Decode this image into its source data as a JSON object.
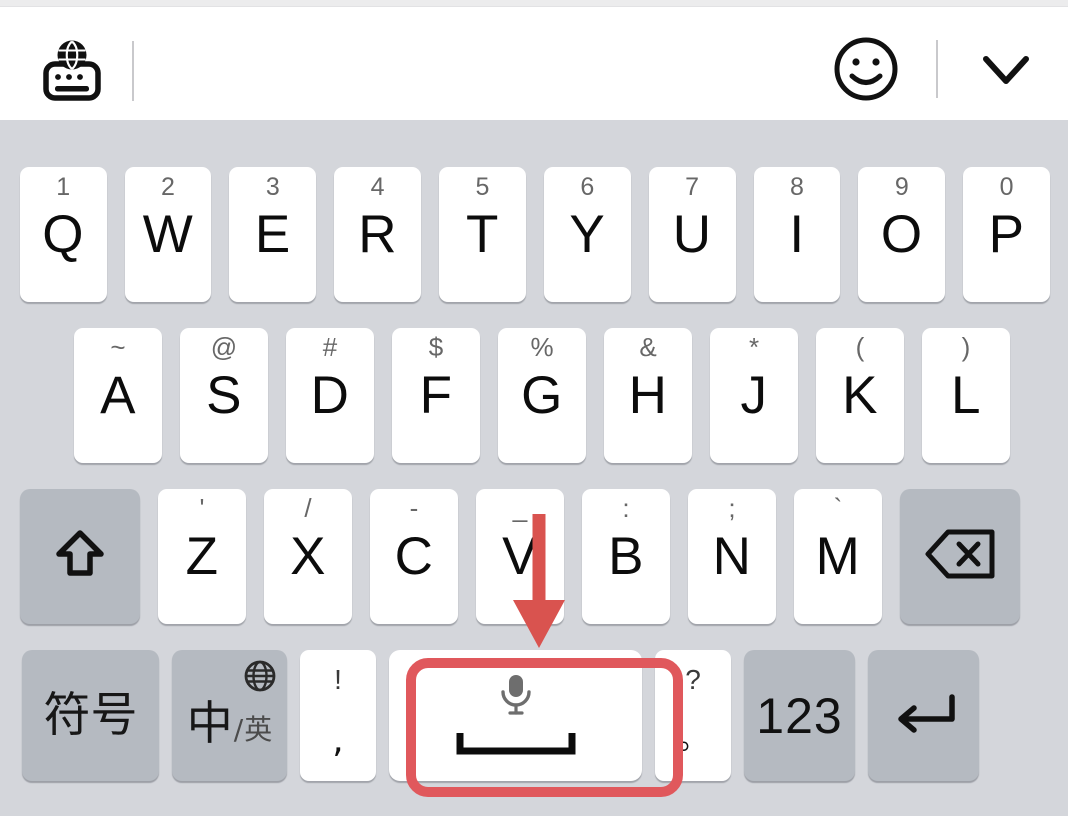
{
  "app": {
    "type": "mobile-soft-keyboard",
    "layout_name": "qwerty-chinese-pinyin"
  },
  "toolbar": {
    "left_icon": "globe-keyboard-icon",
    "left_icon_label": "switch-input-method",
    "divider": "|",
    "emoji_icon": "smiley-face-icon",
    "emoji_label": "emoji",
    "collapse_icon": "chevron-down-icon",
    "collapse_label": "hide-keyboard"
  },
  "keyboard": {
    "rows": [
      {
        "name": "row-1",
        "keys": [
          {
            "main": "Q",
            "sup": "1"
          },
          {
            "main": "W",
            "sup": "2"
          },
          {
            "main": "E",
            "sup": "3"
          },
          {
            "main": "R",
            "sup": "4"
          },
          {
            "main": "T",
            "sup": "5"
          },
          {
            "main": "Y",
            "sup": "6"
          },
          {
            "main": "U",
            "sup": "7"
          },
          {
            "main": "I",
            "sup": "8"
          },
          {
            "main": "O",
            "sup": "9"
          },
          {
            "main": "P",
            "sup": "0"
          }
        ]
      },
      {
        "name": "row-2",
        "keys": [
          {
            "main": "A",
            "sup": "~"
          },
          {
            "main": "S",
            "sup": "@"
          },
          {
            "main": "D",
            "sup": "#"
          },
          {
            "main": "F",
            "sup": "$"
          },
          {
            "main": "G",
            "sup": "%"
          },
          {
            "main": "H",
            "sup": "&"
          },
          {
            "main": "J",
            "sup": "*"
          },
          {
            "main": "K",
            "sup": "("
          },
          {
            "main": "L",
            "sup": ")"
          }
        ]
      },
      {
        "name": "row-3",
        "shift_icon": "shift-up-arrow-icon",
        "shift_label": "shift",
        "backspace_icon": "backspace-delete-icon",
        "backspace_label": "backspace",
        "keys": [
          {
            "main": "Z",
            "sup": "'"
          },
          {
            "main": "X",
            "sup": "/"
          },
          {
            "main": "C",
            "sup": "-"
          },
          {
            "main": "V",
            "sup": "_"
          },
          {
            "main": "B",
            "sup": ":"
          },
          {
            "main": "N",
            "sup": ";"
          },
          {
            "main": "M",
            "sup": "`"
          }
        ]
      }
    ],
    "bottom_row": {
      "symbols_label": "符号",
      "lang_zh": "中",
      "lang_sep": "/",
      "lang_en": "英",
      "lang_globe_icon": "globe-icon",
      "comma_top": "!",
      "comma_bottom": ",",
      "space_mic_icon": "microphone-icon",
      "space_glyph_icon": "spacebar-icon",
      "space_label": "space",
      "period_top": "?",
      "period_bottom": "。",
      "numeric_label": "123",
      "enter_icon": "enter-return-arrow-icon",
      "enter_label": "enter"
    }
  },
  "annotation": {
    "highlight_target": "space",
    "highlight_color": "#e0585c",
    "arrow_icon": "down-arrow-annotation",
    "arrow_color": "#d9534f"
  },
  "colors": {
    "keyboard_background": "#d4d6db",
    "key_white": "#ffffff",
    "key_function_gray": "#b5bac1",
    "text_primary": "#0c0c0c",
    "text_secondary": "#676767",
    "toolbar_background": "#ffffff"
  }
}
